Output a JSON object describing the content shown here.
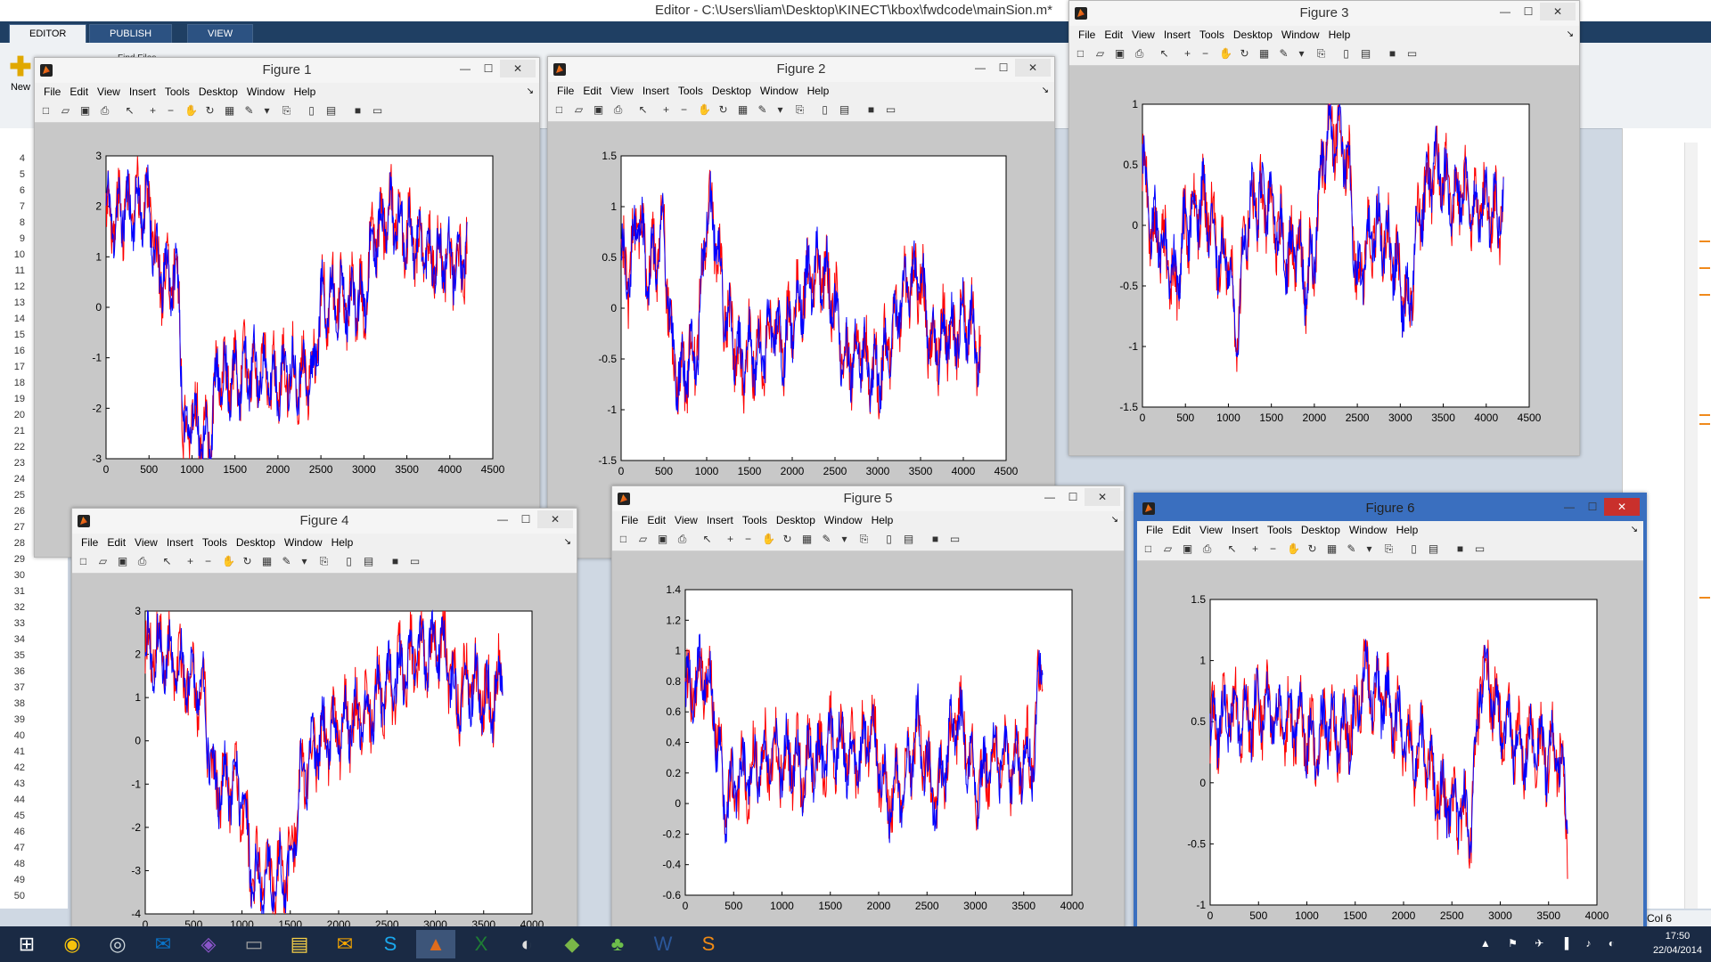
{
  "matlab": {
    "title": "Editor - C:\\Users\\liam\\Desktop\\KINECT\\kbox\\fwdcode\\mainSion.m*",
    "tabs": [
      "EDITOR",
      "PUBLISH",
      "VIEW"
    ],
    "new_label": "New",
    "find_files": "Find Files",
    "line_numbers": [
      "4",
      "5",
      "6",
      "7",
      "8",
      "9",
      "10",
      "11",
      "12",
      "13",
      "14",
      "15",
      "16",
      "17",
      "18",
      "19",
      "20",
      "21",
      "22",
      "23",
      "24",
      "25",
      "26",
      "27",
      "28",
      "29",
      "30",
      "31",
      "32",
      "33",
      "34",
      "35",
      "36",
      "37",
      "38",
      "39",
      "40",
      "41",
      "42",
      "43",
      "44",
      "45",
      "46",
      "47",
      "48",
      "49",
      "50"
    ],
    "status_col": "Col  6"
  },
  "figure_menu": [
    "File",
    "Edit",
    "View",
    "Insert",
    "Tools",
    "Desktop",
    "Window",
    "Help"
  ],
  "figures": [
    {
      "title": "Figure 1",
      "yticks": [
        "3",
        "2",
        "1",
        "0",
        "-1",
        "-2",
        "-3"
      ],
      "xticks": [
        "0",
        "500",
        "1000",
        "1500",
        "2000",
        "2500",
        "3000",
        "3500",
        "4000",
        "4500"
      ]
    },
    {
      "title": "Figure 2",
      "yticks": [
        "1.5",
        "1",
        "0.5",
        "0",
        "-0.5",
        "-1",
        "-1.5"
      ],
      "xticks": [
        "0",
        "500",
        "1000",
        "1500",
        "2000",
        "2500",
        "3000",
        "3500",
        "4000",
        "4500"
      ]
    },
    {
      "title": "Figure 3",
      "yticks": [
        "1",
        "0.5",
        "0",
        "-0.5",
        "-1",
        "-1.5"
      ],
      "xticks": [
        "0",
        "500",
        "1000",
        "1500",
        "2000",
        "2500",
        "3000",
        "3500",
        "4000",
        "4500"
      ]
    },
    {
      "title": "Figure 4",
      "yticks": [
        "3",
        "2",
        "1",
        "0",
        "-1",
        "-2",
        "-3",
        "-4"
      ],
      "xticks": [
        "0",
        "500",
        "1000",
        "1500",
        "2000",
        "2500",
        "3000",
        "3500",
        "4000"
      ]
    },
    {
      "title": "Figure 5",
      "yticks": [
        "1.4",
        "1.2",
        "1",
        "0.8",
        "0.6",
        "0.4",
        "0.2",
        "0",
        "-0.2",
        "-0.4",
        "-0.6"
      ],
      "xticks": [
        "0",
        "500",
        "1000",
        "1500",
        "2000",
        "2500",
        "3000",
        "3500",
        "4000"
      ]
    },
    {
      "title": "Figure 6",
      "yticks": [
        "1.5",
        "1",
        "0.5",
        "0",
        "-0.5",
        "-1"
      ],
      "xticks": [
        "0",
        "500",
        "1000",
        "1500",
        "2000",
        "2500",
        "3000",
        "3500",
        "4000"
      ]
    }
  ],
  "colors": {
    "series_a": "#0000ff",
    "series_b": "#ff0000",
    "active_border": "#3a6fbf"
  },
  "taskbar": {
    "time": "17:50",
    "date": "22/04/2014",
    "icons": [
      "windows-start-icon",
      "chrome-icon",
      "steam-icon",
      "outlook-icon",
      "visual-studio-icon",
      "kinect-icon",
      "file-explorer-icon",
      "outlook-alt-icon",
      "skype-icon",
      "matlab-icon",
      "excel-icon",
      "media-icon",
      "evernote-icon",
      "clover-icon",
      "word-icon",
      "sublime-icon"
    ]
  },
  "chart_data": [
    {
      "type": "line",
      "figure": "Figure 1",
      "xlim": [
        0,
        4500
      ],
      "ylim": [
        -3,
        3
      ],
      "series": [
        {
          "color": "blue",
          "x": [
            0,
            100,
            200,
            300,
            400,
            500,
            600,
            800,
            850,
            900,
            950,
            1000,
            1100,
            1200,
            1300,
            1400,
            1500,
            1600,
            1700,
            1800,
            1900,
            2000,
            2100,
            2200,
            2300,
            2400,
            2500,
            2600,
            2700,
            2800,
            2900,
            3000,
            3100,
            3200,
            3300,
            3400,
            3500,
            3600,
            3700,
            3800,
            3900,
            4000,
            4100,
            4200
          ],
          "y": [
            2.0,
            1.7,
            2.0,
            1.9,
            2.0,
            2.0,
            0.7,
            0.6,
            0.4,
            -2.5,
            -2.4,
            -2.0,
            -2.6,
            -2.7,
            -1.3,
            -1.5,
            -1.4,
            -1.3,
            -1.2,
            -1.3,
            -1.4,
            -1.5,
            -1.2,
            -1.3,
            -1.3,
            -1.5,
            0.1,
            0.2,
            0.2,
            0.1,
            0.2,
            0.0,
            1.3,
            1.7,
            1.9,
            1.6,
            1.5,
            1.3,
            1.2,
            1.0,
            1.0,
            0.9,
            0.9,
            1.0
          ]
        }
      ]
    },
    {
      "type": "line",
      "figure": "Figure 2",
      "xlim": [
        0,
        4500
      ],
      "ylim": [
        -1.5,
        1.5
      ],
      "series": [
        {
          "color": "blue",
          "x": [
            0,
            100,
            200,
            300,
            400,
            500,
            600,
            700,
            800,
            900,
            1000,
            1100,
            1200,
            1300,
            1400,
            1500,
            1600,
            1700,
            1800,
            1900,
            2000,
            2100,
            2200,
            2300,
            2400,
            2500,
            2600,
            2700,
            2800,
            2900,
            3000,
            3100,
            3200,
            3300,
            3400,
            3500,
            3600,
            3700,
            3800,
            3900,
            4000,
            4100,
            4200
          ],
          "y": [
            0.5,
            0.3,
            1.0,
            0.3,
            0.5,
            0.8,
            -0.5,
            -0.7,
            -0.5,
            -0.4,
            1.0,
            0.8,
            0.0,
            -0.2,
            -0.6,
            -0.4,
            -0.5,
            -0.3,
            -0.2,
            -0.4,
            -0.1,
            0.1,
            0.3,
            0.4,
            0.3,
            0.0,
            -0.5,
            -0.5,
            -0.4,
            -0.6,
            -0.7,
            -0.4,
            -0.2,
            0.2,
            0.3,
            0.3,
            -0.3,
            -0.4,
            -0.2,
            -0.3,
            -0.1,
            -0.2,
            -0.5
          ]
        }
      ]
    },
    {
      "type": "line",
      "figure": "Figure 3",
      "xlim": [
        0,
        4500
      ],
      "ylim": [
        -1.5,
        1.0
      ],
      "series": [
        {
          "color": "blue",
          "x": [
            0,
            100,
            200,
            300,
            400,
            500,
            600,
            700,
            800,
            900,
            1000,
            1100,
            1200,
            1300,
            1400,
            1500,
            1600,
            1700,
            1800,
            1900,
            2000,
            2100,
            2200,
            2300,
            2400,
            2500,
            2600,
            2700,
            2800,
            2900,
            3000,
            3100,
            3200,
            3300,
            3400,
            3500,
            3600,
            3700,
            3800,
            3900,
            4000,
            4100,
            4200
          ],
          "y": [
            0.5,
            0.0,
            -0.1,
            -0.3,
            -0.5,
            0.0,
            0.1,
            0.2,
            0.0,
            -0.3,
            -0.2,
            -1.0,
            0.0,
            0.2,
            0.2,
            0.2,
            -0.1,
            -0.3,
            -0.1,
            -0.5,
            -0.2,
            0.6,
            0.8,
            0.7,
            0.5,
            -0.5,
            -0.2,
            0.0,
            -0.1,
            -0.2,
            -0.5,
            -0.7,
            0.0,
            0.3,
            0.5,
            0.4,
            0.2,
            0.3,
            0.2,
            0.1,
            0.2,
            0.1,
            0.1
          ]
        }
      ]
    },
    {
      "type": "line",
      "figure": "Figure 4",
      "xlim": [
        0,
        4000
      ],
      "ylim": [
        -4,
        3
      ],
      "series": [
        {
          "color": "blue",
          "x": [
            0,
            100,
            200,
            300,
            400,
            500,
            600,
            700,
            800,
            900,
            1000,
            1100,
            1200,
            1300,
            1400,
            1500,
            1600,
            1700,
            1800,
            1900,
            2000,
            2100,
            2200,
            2300,
            2400,
            2500,
            2600,
            2700,
            2800,
            2900,
            3000,
            3100,
            3200,
            3300,
            3400,
            3500,
            3600,
            3700
          ],
          "y": [
            2.0,
            2.1,
            2.0,
            1.8,
            1.5,
            1.3,
            1.2,
            -1.0,
            -1.0,
            -1.0,
            -1.2,
            -3.0,
            -3.2,
            -3.2,
            -3.1,
            -3.0,
            -1.0,
            -0.5,
            0.0,
            0.1,
            0.1,
            0.4,
            0.5,
            0.6,
            1.0,
            1.2,
            1.5,
            1.7,
            2.0,
            2.1,
            2.2,
            2.2,
            1.0,
            1.2,
            1.3,
            1.0,
            1.0,
            1.5
          ]
        }
      ]
    },
    {
      "type": "line",
      "figure": "Figure 5",
      "xlim": [
        0,
        4000
      ],
      "ylim": [
        -0.6,
        1.4
      ],
      "series": [
        {
          "color": "blue",
          "x": [
            0,
            100,
            200,
            300,
            400,
            500,
            600,
            700,
            800,
            900,
            1000,
            1100,
            1200,
            1300,
            1400,
            1500,
            1600,
            1700,
            1800,
            1900,
            2000,
            2100,
            2200,
            2300,
            2400,
            2500,
            2600,
            2700,
            2800,
            2900,
            3000,
            3100,
            3200,
            3300,
            3400,
            3500,
            3600,
            3700
          ],
          "y": [
            0.7,
            0.8,
            0.9,
            0.6,
            0.0,
            0.1,
            0.2,
            0.2,
            0.3,
            0.3,
            0.3,
            0.3,
            0.2,
            0.3,
            0.3,
            0.4,
            0.4,
            0.3,
            0.3,
            0.5,
            0.3,
            0.0,
            0.1,
            0.2,
            0.5,
            0.2,
            0.0,
            0.3,
            0.6,
            0.4,
            0.1,
            0.2,
            0.3,
            0.3,
            0.2,
            0.3,
            0.3,
            1.1
          ]
        }
      ]
    },
    {
      "type": "line",
      "figure": "Figure 6",
      "xlim": [
        0,
        4000
      ],
      "ylim": [
        -1,
        1.5
      ],
      "series": [
        {
          "color": "blue",
          "x": [
            0,
            100,
            200,
            300,
            400,
            500,
            600,
            700,
            800,
            900,
            1000,
            1100,
            1200,
            1300,
            1400,
            1500,
            1600,
            1700,
            1800,
            1900,
            2000,
            2100,
            2200,
            2300,
            2400,
            2500,
            2600,
            2700,
            2800,
            2900,
            3000,
            3100,
            3200,
            3300,
            3400,
            3500,
            3600,
            3700
          ],
          "y": [
            0.4,
            0.5,
            0.6,
            0.5,
            0.5,
            0.6,
            0.6,
            0.5,
            0.5,
            0.5,
            0.4,
            0.3,
            0.5,
            0.4,
            0.4,
            0.5,
            0.9,
            0.7,
            0.7,
            0.6,
            0.4,
            0.2,
            0.3,
            0.0,
            -0.1,
            -0.2,
            -0.2,
            -0.3,
            0.9,
            0.8,
            0.5,
            0.4,
            0.3,
            0.3,
            0.3,
            0.2,
            0.3,
            -0.4
          ]
        }
      ]
    }
  ]
}
